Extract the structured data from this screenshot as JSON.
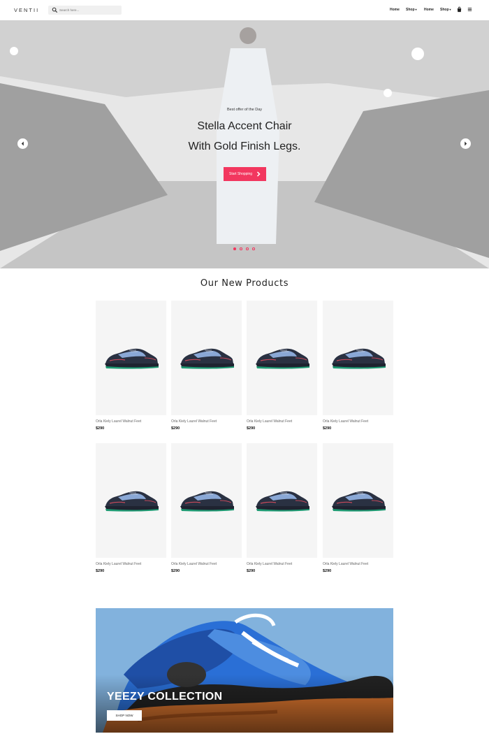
{
  "header": {
    "logo": "VENTII",
    "search_placeholder": "Search here...",
    "nav": [
      {
        "label": "Home"
      },
      {
        "label": "Shop"
      },
      {
        "label": "Home"
      },
      {
        "label": "Shop"
      }
    ]
  },
  "hero": {
    "kicker": "Best offer of the Day",
    "title_line1": "Stella Accent Chair",
    "title_line2": "With Gold Finish Legs.",
    "cta_label": "Start Shopping",
    "slide_count": 4,
    "active_slide": 1,
    "accent_color": "#f2375f"
  },
  "products": {
    "title": "Our New Products",
    "items": [
      {
        "name": "Orla Kiely Laurel Walnut Feet",
        "price": "$290"
      },
      {
        "name": "Orla Kiely Laurel Walnut Feet",
        "price": "$290"
      },
      {
        "name": "Orla Kiely Laurel Walnut Feet",
        "price": "$290"
      },
      {
        "name": "Orla Kiely Laurel Walnut Feet",
        "price": "$290"
      },
      {
        "name": "Orla Kiely Laurel Walnut Feet",
        "price": "$290"
      },
      {
        "name": "Orla Kiely Laurel Walnut Feet",
        "price": "$290"
      },
      {
        "name": "Orla Kiely Laurel Walnut Feet",
        "price": "$290"
      },
      {
        "name": "Orla Kiely Laurel Walnut Feet",
        "price": "$290"
      }
    ]
  },
  "banner": {
    "title": "YEEZY COLLECTION",
    "button_label": "SHOP NOW",
    "bg_color": "#82b2dd"
  },
  "icons": [
    "search-icon",
    "chevron-down-icon",
    "bag-icon",
    "menu-icon",
    "chevron-left-icon",
    "chevron-right-icon",
    "arrow-right-icon"
  ]
}
